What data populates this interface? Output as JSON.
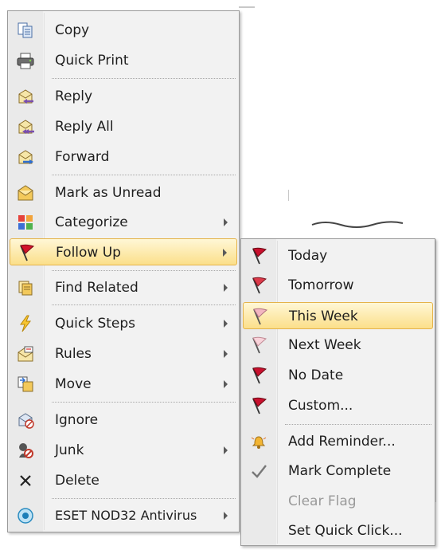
{
  "context_menu": {
    "items": [
      {
        "label": "Copy",
        "icon": "copy-icon"
      },
      {
        "label": "Quick Print",
        "icon": "printer-icon"
      },
      {
        "label": "Reply",
        "icon": "reply-icon"
      },
      {
        "label": "Reply All",
        "icon": "reply-all-icon"
      },
      {
        "label": "Forward",
        "icon": "forward-icon"
      },
      {
        "label": "Mark as Unread",
        "icon": "mark-unread-icon"
      },
      {
        "label": "Categorize",
        "icon": "categorize-icon",
        "submenu": true
      },
      {
        "label": "Follow Up",
        "icon": "red-flag-icon",
        "submenu": true,
        "highlighted": true
      },
      {
        "label": "Find Related",
        "icon": "find-related-icon",
        "submenu": true
      },
      {
        "label": "Quick Steps",
        "icon": "lightning-icon",
        "submenu": true
      },
      {
        "label": "Rules",
        "icon": "rules-icon",
        "submenu": true
      },
      {
        "label": "Move",
        "icon": "move-icon",
        "submenu": true
      },
      {
        "label": "Ignore",
        "icon": "ignore-icon"
      },
      {
        "label": "Junk",
        "icon": "junk-icon",
        "submenu": true
      },
      {
        "label": "Delete",
        "icon": "delete-x-icon"
      },
      {
        "label": "ESET NOD32 Antivirus",
        "icon": "eset-icon",
        "submenu": true
      }
    ]
  },
  "follow_up_submenu": {
    "items": [
      {
        "label": "Today",
        "icon": "flag-today-icon"
      },
      {
        "label": "Tomorrow",
        "icon": "flag-tomorrow-icon"
      },
      {
        "label": "This Week",
        "icon": "flag-this-week-icon",
        "highlighted": true
      },
      {
        "label": "Next Week",
        "icon": "flag-next-week-icon"
      },
      {
        "label": "No Date",
        "icon": "flag-no-date-icon"
      },
      {
        "label": "Custom...",
        "icon": "flag-custom-icon"
      },
      {
        "label": "Add Reminder...",
        "icon": "reminder-bell-icon"
      },
      {
        "label": "Mark Complete",
        "icon": "checkmark-icon"
      },
      {
        "label": "Clear Flag",
        "icon": "",
        "disabled": true
      },
      {
        "label": "Set Quick Click...",
        "icon": ""
      }
    ]
  },
  "colors": {
    "highlight_top": "#fff7d6",
    "highlight_bottom": "#fbdf8a",
    "highlight_border": "#e5b34a",
    "flag_red": "#c8102e",
    "menu_bg": "#f2f2f2"
  }
}
